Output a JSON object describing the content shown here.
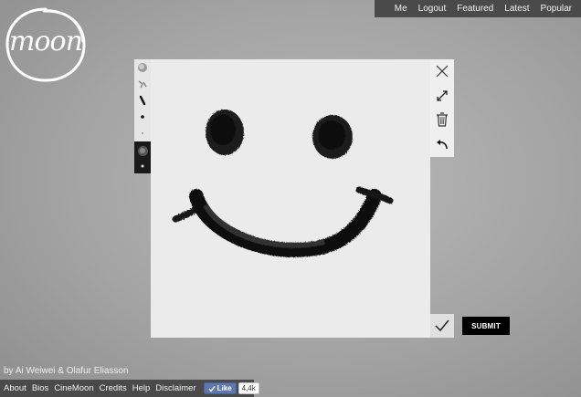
{
  "logo": {
    "text": "moon"
  },
  "topnav": {
    "items": [
      "Me",
      "Logout",
      "Featured",
      "Latest",
      "Popular"
    ]
  },
  "drawing_tools": {
    "icons": [
      "charcoal-brush-icon",
      "smudge-brush-icon",
      "thick-pen-icon",
      "medium-dot-icon",
      "small-dot-icon",
      "swatch-dark-icon",
      "swatch-dot-icon"
    ]
  },
  "actions": {
    "icons": [
      "close-icon",
      "expand-icon",
      "trash-icon",
      "undo-icon",
      "checkmark-icon"
    ]
  },
  "submit_label": "SUBMIT",
  "credits": "by Ai Weiwei & Olafur Eliasson",
  "bottomnav": {
    "items": [
      "About",
      "Bios",
      "CineMoon",
      "Credits",
      "Help",
      "Disclaimer"
    ]
  },
  "facebook": {
    "like_label": "Like",
    "count": "4,4k"
  },
  "colors": {
    "nav_bg": "#4a4a4a",
    "canvas_bg": "#ebebeb",
    "submit_bg": "#000000"
  }
}
